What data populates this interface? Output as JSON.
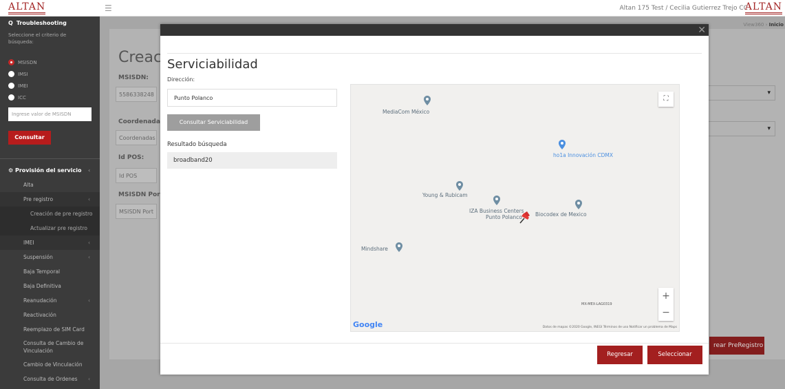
{
  "header": {
    "logo": "ALTAN",
    "logo_right": "ALTAN",
    "menu_icon": "hamburger-icon",
    "user": "Altan 175 Test / Cecilia Gutierrez Trejo CC"
  },
  "sidebar": {
    "section": "Troubleshooting",
    "help": "Seleccione el criterio de búsqueda:",
    "radios": [
      "MSISDN",
      "IMSI",
      "IMEI",
      "ICC"
    ],
    "input_placeholder": "Ingrese valor de MSISDN",
    "button": "Consultar",
    "nav_main": "Provisión del servicio",
    "nav": {
      "alta": "Alta",
      "pre_registro": "Pre registro",
      "creacion": "Creación de pre registro",
      "actualizar": "Actualizar pre registro",
      "imei": "IMEI",
      "suspension": "Suspensión",
      "baja_temporal": "Baja Temporal",
      "baja_definitiva": "Baja Definitiva",
      "reanudacion": "Reanudación",
      "reactivacion": "Reactivación",
      "reemplazo": "Reemplazo de SIM Card",
      "consulta_cambio": "Consulta de Cambio de Vinculación",
      "cambio_vinculacion": "Cambio de Vinculación",
      "consulta_ordenes": "Consulta de Ordenes"
    }
  },
  "background": {
    "breadcrumb_1": "View360",
    "breadcrumb_2": "Inicio",
    "title": "Creació",
    "msisdn_label": "MSISDN:",
    "msisdn_value": "5586338248",
    "coord_label": "Coordenadas:",
    "coord_placeholder": "Coordenadas",
    "idpos_label": "Id POS:",
    "idpos_placeholder": "Id POS",
    "portec_label": "MSISDN Portec",
    "portec_placeholder": "MSISDN Port",
    "create_button": "rear PreRegistro"
  },
  "modal": {
    "title": "Serviciabilidad",
    "direccion_label": "Dirección:",
    "direccion_value": "Punto Polanco",
    "consultar_button": "Consultar Serviciabilidad",
    "resultado_label": "Resultado búsqueda",
    "resultado_value": "broadband20",
    "close": "✕",
    "regresar": "Regresar",
    "seleccionar": "Seleccionar"
  },
  "map": {
    "places": {
      "mediacom": "MediaCom México",
      "hola": "ho1a Innovación CDMX",
      "young": "Young & Rubicam",
      "iza_1": "IZA Business Centers",
      "iza_2": "Punto Polanco",
      "biocodex": "Biocodex de Mexico",
      "mindshare": "Mindshare"
    },
    "code": "MX-MEX-LAG0319",
    "google": "Google",
    "attribution": "Datos de mapas ©2020 Google, INEGI   Términos de uso   Notificar un problema de Maps",
    "zoom_in": "+",
    "zoom_out": "−",
    "fullscreen": "⛶"
  }
}
